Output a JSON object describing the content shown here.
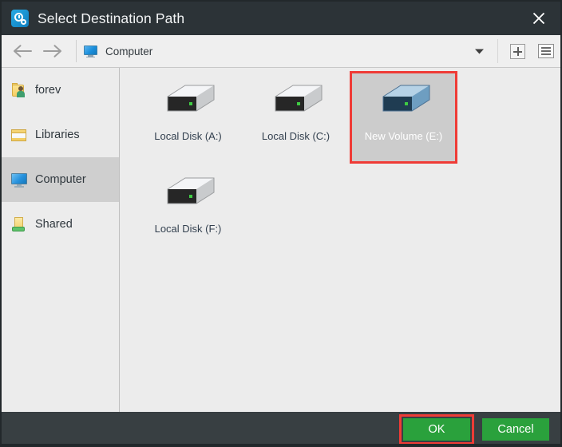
{
  "window": {
    "title": "Select Destination Path",
    "app_icon": "clock-gear-icon",
    "close_icon": "close-icon",
    "titlebar_color": "#2c3337",
    "footer_color": "#383f42",
    "accent_color": "#2aa13c",
    "annotation_color": "#ef3b36"
  },
  "toolbar": {
    "back_icon": "arrow-left-icon",
    "forward_icon": "arrow-right-icon",
    "breadcrumb_icon": "computer-monitor-icon",
    "breadcrumb_label": "Computer",
    "dropdown_icon": "chevron-down-icon",
    "new_folder_icon": "plus-box-icon",
    "view_mode_icon": "list-view-icon"
  },
  "sidebar": {
    "items": [
      {
        "label": "forev",
        "icon": "user-folder-icon",
        "selected": false
      },
      {
        "label": "Libraries",
        "icon": "libraries-icon",
        "selected": false
      },
      {
        "label": "Computer",
        "icon": "computer-monitor-icon",
        "selected": true
      },
      {
        "label": "Shared",
        "icon": "shared-folder-icon",
        "selected": false
      }
    ]
  },
  "main": {
    "items": [
      {
        "label": "Local Disk (A:)",
        "icon": "hard-drive-icon",
        "selected": false,
        "annotated": false
      },
      {
        "label": "Local Disk (C:)",
        "icon": "hard-drive-icon",
        "selected": false,
        "annotated": false
      },
      {
        "label": "New Volume (E:)",
        "icon": "hard-drive-icon",
        "selected": true,
        "annotated": true
      },
      {
        "label": "Local Disk (F:)",
        "icon": "hard-drive-icon",
        "selected": false,
        "annotated": false
      }
    ]
  },
  "footer": {
    "ok_label": "OK",
    "ok_annotated": true,
    "cancel_label": "Cancel",
    "cancel_annotated": false
  }
}
